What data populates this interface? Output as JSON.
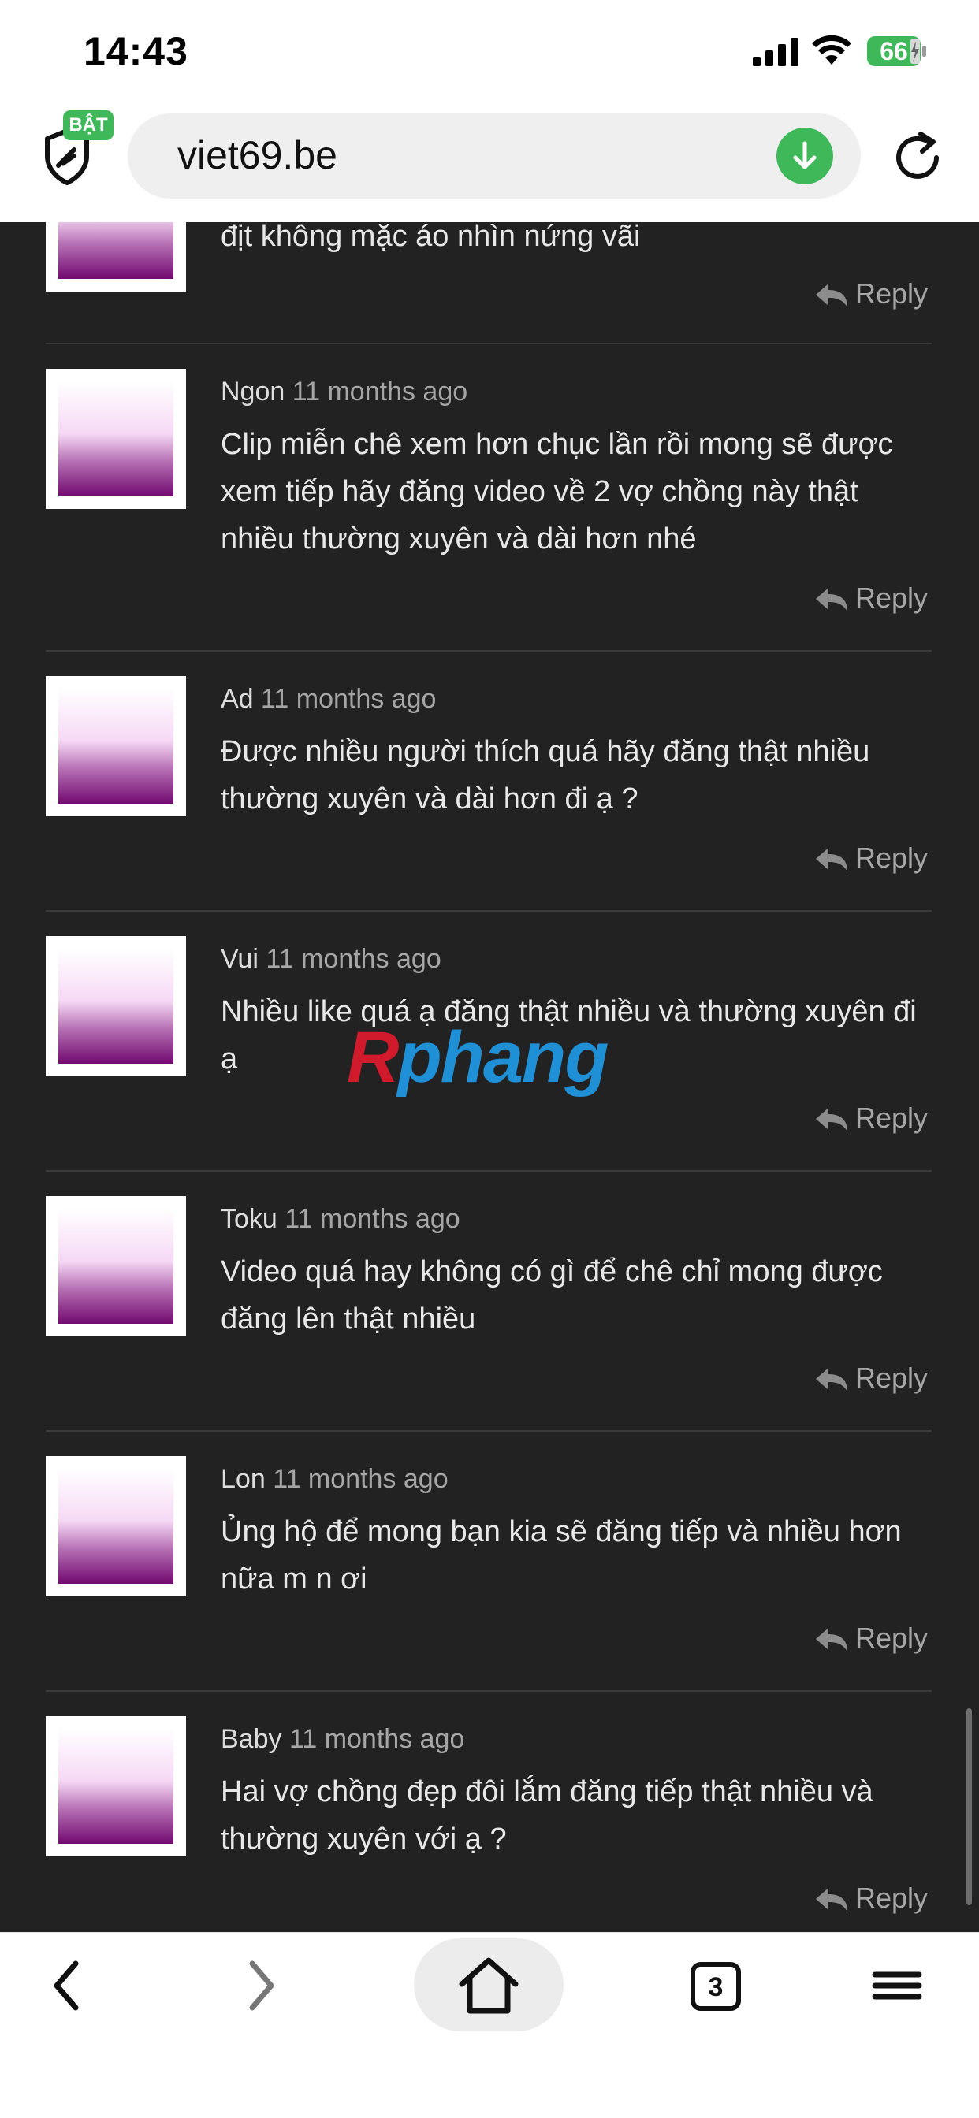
{
  "status_bar": {
    "time": "14:43",
    "battery_level": "66",
    "icons": [
      "signal-icon",
      "wifi-icon",
      "battery-charging-icon"
    ]
  },
  "browser": {
    "shield_badge": "BẬT",
    "url": "viet69.be",
    "accent_color": "#3fb85a",
    "icons": [
      "shield-icon",
      "download-icon",
      "reload-icon"
    ]
  },
  "watermark": {
    "part_a": "R",
    "part_b": "phang"
  },
  "comments": [
    {
      "author": "",
      "time": "",
      "text": "địt không mặc áo nhìn nứng vãi",
      "reply": "Reply"
    },
    {
      "author": "Ngon",
      "time": "11 months ago",
      "text": "Clip miễn chê xem hơn chục lần rồi mong sẽ được xem tiếp hãy đăng video về 2 vợ chồng này thật nhiều thường xuyên và dài hơn nhé",
      "reply": "Reply"
    },
    {
      "author": "Ad",
      "time": "11 months ago",
      "text": "Được nhiều người thích quá hãy đăng thật nhiều thường xuyên và dài hơn đi ạ ?",
      "reply": "Reply"
    },
    {
      "author": "Vui",
      "time": "11 months ago",
      "text": "Nhiều like quá ạ đăng thật nhiều và thường xuyên đi ạ",
      "reply": "Reply"
    },
    {
      "author": "Toku",
      "time": "11 months ago",
      "text": "Video quá hay không có gì để chê chỉ mong được đăng lên thật nhiều",
      "reply": "Reply"
    },
    {
      "author": "Lon",
      "time": "11 months ago",
      "text": "Ủng hộ để mong bạn kia sẽ đăng tiếp và nhiều hơn nữa m n ơi",
      "reply": "Reply"
    },
    {
      "author": "Baby",
      "time": "11 months ago",
      "text": "Hai vợ chồng đẹp đôi lắm đăng tiếp thật nhiều và thường xuyên với ạ ?",
      "reply": "Reply"
    }
  ],
  "bottom_nav": {
    "tab_count": "3",
    "icons": [
      "back-icon",
      "forward-icon",
      "home-icon",
      "tabs-icon",
      "menu-icon"
    ]
  }
}
